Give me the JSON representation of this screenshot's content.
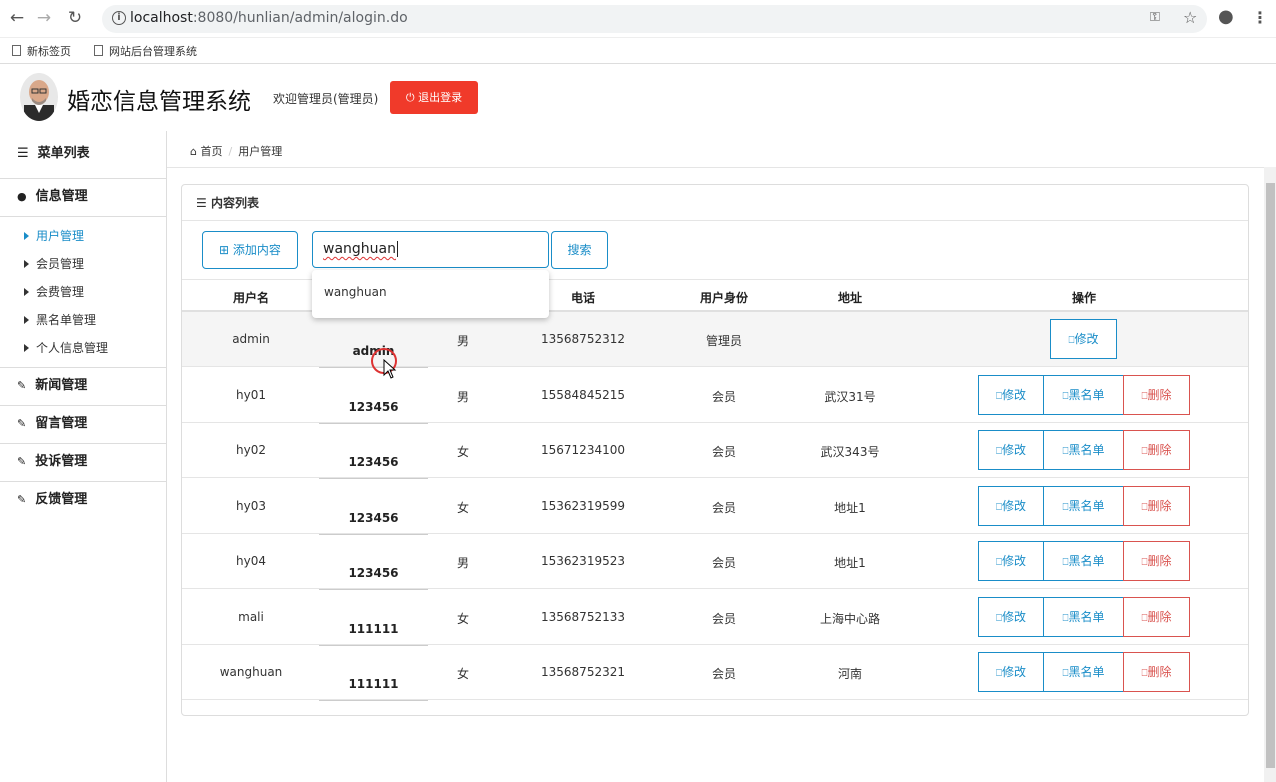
{
  "browser": {
    "url_host": "localhost",
    "url_path": ":8080/hunlian/admin/alogin.do",
    "bookmarks": [
      "新标签页",
      "网站后台管理系统"
    ]
  },
  "header": {
    "title": "婚恋信息管理系统",
    "welcome": "欢迎管理员(管理员)",
    "logout": "退出登录"
  },
  "sidebar": {
    "menu_title": "菜单列表",
    "groups": [
      {
        "label": "信息管理",
        "items": [
          "用户管理",
          "会员管理",
          "会费管理",
          "黑名单管理",
          "个人信息管理"
        ],
        "active": "用户管理"
      },
      {
        "label": "新闻管理"
      },
      {
        "label": "留言管理"
      },
      {
        "label": "投诉管理"
      },
      {
        "label": "反馈管理"
      }
    ]
  },
  "breadcrumb": {
    "home": "首页",
    "current": "用户管理"
  },
  "panel": {
    "title": "内容列表",
    "add_button": "添加内容",
    "search_value": "wanghuan",
    "search_button": "搜索",
    "autocomplete": "wanghuan"
  },
  "table": {
    "headers": [
      "用户名",
      "电话",
      "用户身份",
      "地址",
      "操作"
    ],
    "rows": [
      {
        "username": "admin",
        "password": "admin",
        "gender": "男",
        "phone": "13568752312",
        "role": "管理员",
        "address": ""
      },
      {
        "username": "hy01",
        "password": "123456",
        "gender": "男",
        "phone": "15584845215",
        "role": "会员",
        "address": "武汉31号"
      },
      {
        "username": "hy02",
        "password": "123456",
        "gender": "女",
        "phone": "15671234100",
        "role": "会员",
        "address": "武汉343号"
      },
      {
        "username": "hy03",
        "password": "123456",
        "gender": "女",
        "phone": "15362319599",
        "role": "会员",
        "address": "地址1"
      },
      {
        "username": "hy04",
        "password": "123456",
        "gender": "男",
        "phone": "15362319523",
        "role": "会员",
        "address": "地址1"
      },
      {
        "username": "mali",
        "password": "111111",
        "gender": "女",
        "phone": "13568752133",
        "role": "会员",
        "address": "上海中心路"
      },
      {
        "username": "wanghuan",
        "password": "111111",
        "gender": "女",
        "phone": "13568752321",
        "role": "会员",
        "address": "河南"
      }
    ],
    "actions": {
      "edit": "修改",
      "blacklist": "黑名单",
      "delete": "删除"
    }
  },
  "colors": {
    "accent": "#1a8dc8",
    "danger": "#d9534f",
    "logout_bg": "#f03a2a"
  }
}
